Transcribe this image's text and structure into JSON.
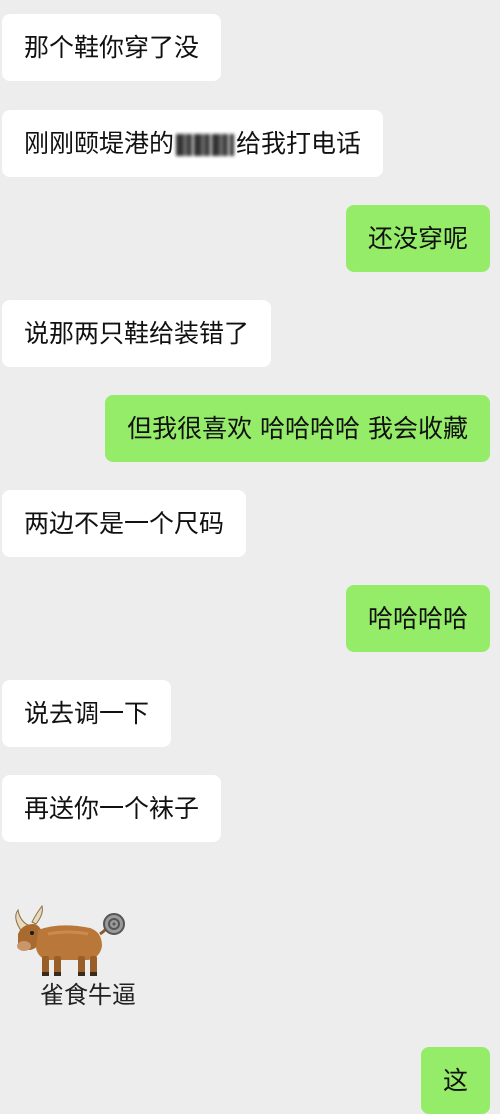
{
  "messages": [
    {
      "side": "left",
      "text": "那个鞋你穿了没"
    },
    {
      "side": "left",
      "text_before": "刚刚颐堤港的",
      "text_after": "给我打电话"
    },
    {
      "side": "right",
      "text": "还没穿呢"
    },
    {
      "side": "left",
      "text": "说那两只鞋给装错了"
    },
    {
      "side": "right",
      "text": "但我很喜欢 哈哈哈哈 我会收藏"
    },
    {
      "side": "left",
      "text": "两边不是一个尺码"
    },
    {
      "side": "right",
      "text": "哈哈哈哈"
    },
    {
      "side": "left",
      "text": "说去调一下"
    },
    {
      "side": "left",
      "text": "再送你一个袜子"
    },
    {
      "side": "right",
      "text": "这"
    }
  ],
  "sticker": {
    "caption": "雀食牛逼",
    "icon": "bull-icon"
  },
  "colors": {
    "background": "#ededed",
    "left_bubble": "#ffffff",
    "right_bubble": "#95ec69",
    "text": "#111111"
  }
}
